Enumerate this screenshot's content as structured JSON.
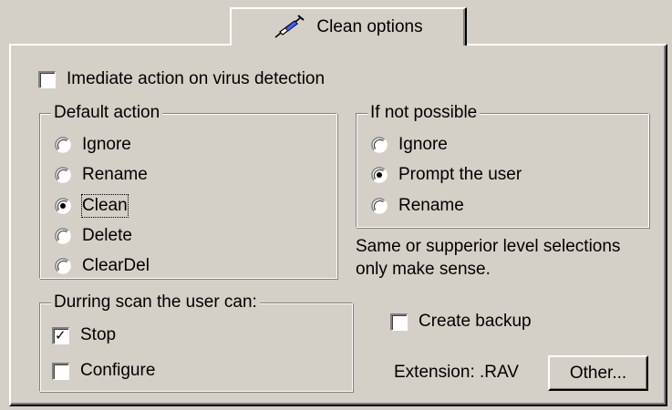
{
  "tab": {
    "label": "Clean options",
    "icon": "syringe-icon"
  },
  "immediate": {
    "label": "Imediate action on virus detection",
    "checked": false
  },
  "default_action": {
    "title": "Default action",
    "options": [
      {
        "label": "Ignore",
        "selected": false
      },
      {
        "label": "Rename",
        "selected": false
      },
      {
        "label": "Clean",
        "selected": true
      },
      {
        "label": "Delete",
        "selected": false
      },
      {
        "label": "ClearDel",
        "selected": false
      }
    ]
  },
  "if_not_possible": {
    "title": "If not possible",
    "options": [
      {
        "label": "Ignore",
        "selected": false
      },
      {
        "label": "Prompt the user",
        "selected": true
      },
      {
        "label": "Rename",
        "selected": false
      }
    ]
  },
  "note": {
    "line1": "Same or supperior level selections",
    "line2": "only make sense."
  },
  "during_scan": {
    "title": "Durring scan the user can:",
    "stop": {
      "label": "Stop",
      "checked": true
    },
    "configure": {
      "label": "Configure",
      "checked": false
    }
  },
  "backup": {
    "label": "Create backup",
    "checked": false
  },
  "extension": {
    "text": "Extension: .RAV"
  },
  "other_button": {
    "label": "Other..."
  }
}
